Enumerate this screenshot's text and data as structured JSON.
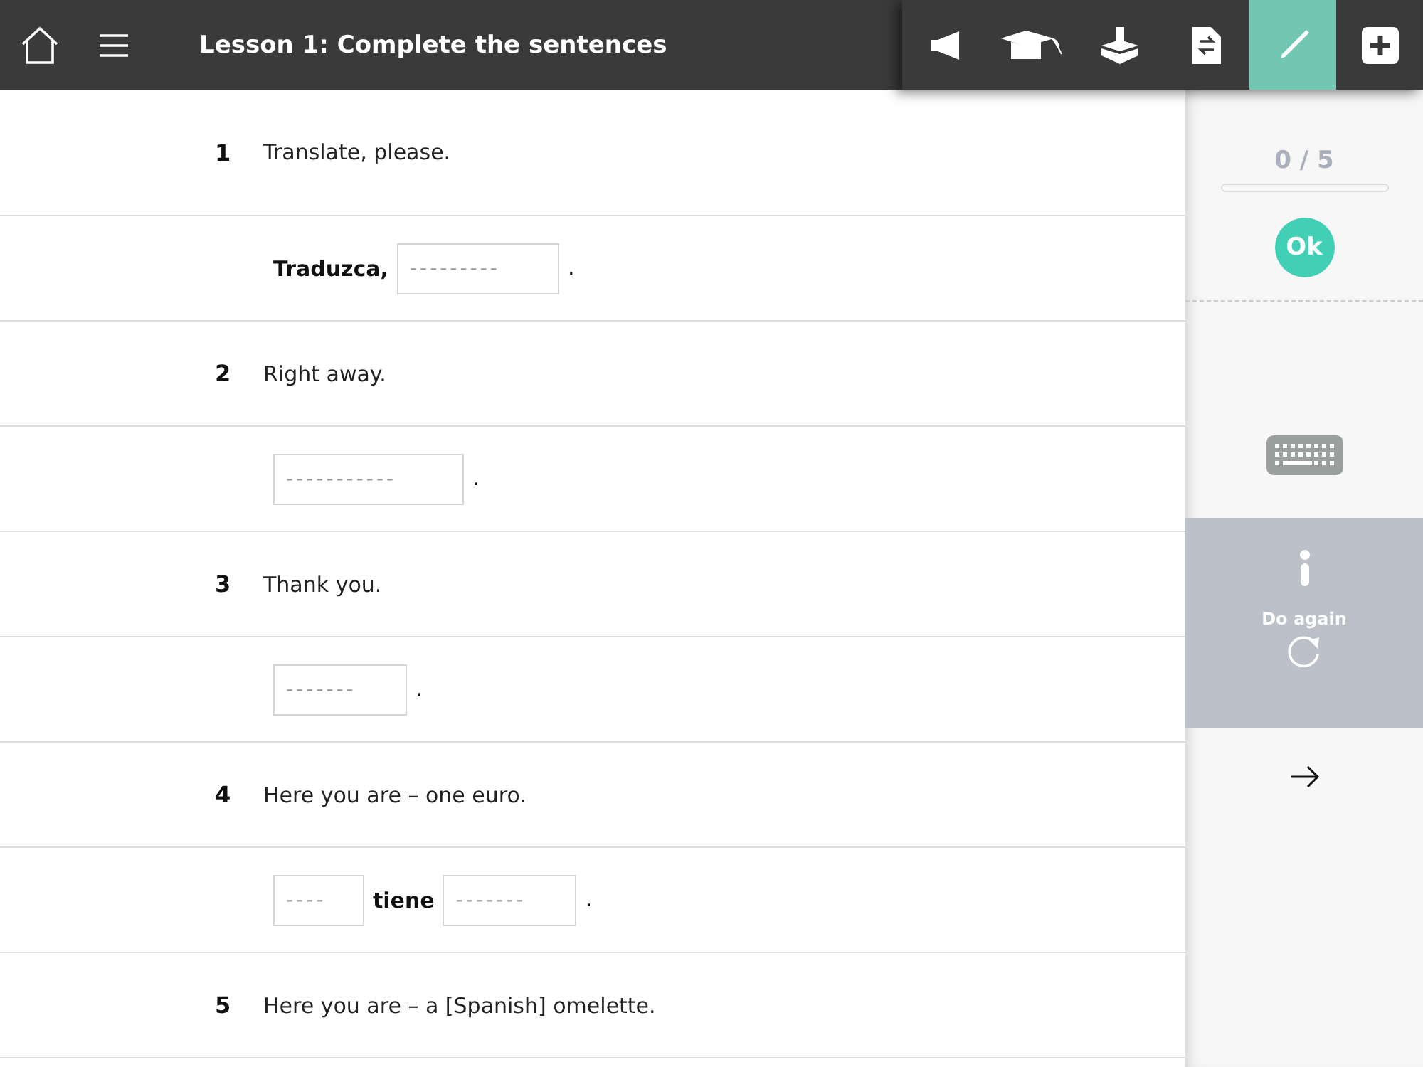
{
  "header": {
    "title": "Lesson 1: Complete the sentences"
  },
  "tools": [
    {
      "kind": "speaker",
      "selected": false
    },
    {
      "kind": "cap",
      "selected": false
    },
    {
      "kind": "box",
      "selected": false
    },
    {
      "kind": "doc",
      "selected": false
    },
    {
      "kind": "pen",
      "selected": true
    },
    {
      "kind": "plus",
      "selected": false
    }
  ],
  "exercises": [
    {
      "number": "1",
      "prompt": "Translate, please.",
      "answer": [
        {
          "kind": "text",
          "text": "Traduzca,"
        },
        {
          "kind": "blank",
          "placeholder": "---------"
        },
        {
          "kind": "text",
          "text": "."
        }
      ]
    },
    {
      "number": "2",
      "prompt": "Right away.",
      "answer": [
        {
          "kind": "blank",
          "placeholder": "-----------"
        },
        {
          "kind": "text",
          "text": "."
        }
      ]
    },
    {
      "number": "3",
      "prompt": "Thank you.",
      "answer": [
        {
          "kind": "blank",
          "placeholder": "-------"
        },
        {
          "kind": "text",
          "text": "."
        }
      ]
    },
    {
      "number": "4",
      "prompt": "Here you are – one euro.",
      "answer": [
        {
          "kind": "blank",
          "placeholder": "----"
        },
        {
          "kind": "text",
          "text": "tiene"
        },
        {
          "kind": "blank",
          "placeholder": "-------"
        },
        {
          "kind": "text",
          "text": "."
        }
      ]
    },
    {
      "number": "5",
      "prompt": "Here you are – a [Spanish] omelette."
    }
  ],
  "sidebar": {
    "score": "0 / 5",
    "ok": "Ok",
    "do_again": "Do again"
  }
}
